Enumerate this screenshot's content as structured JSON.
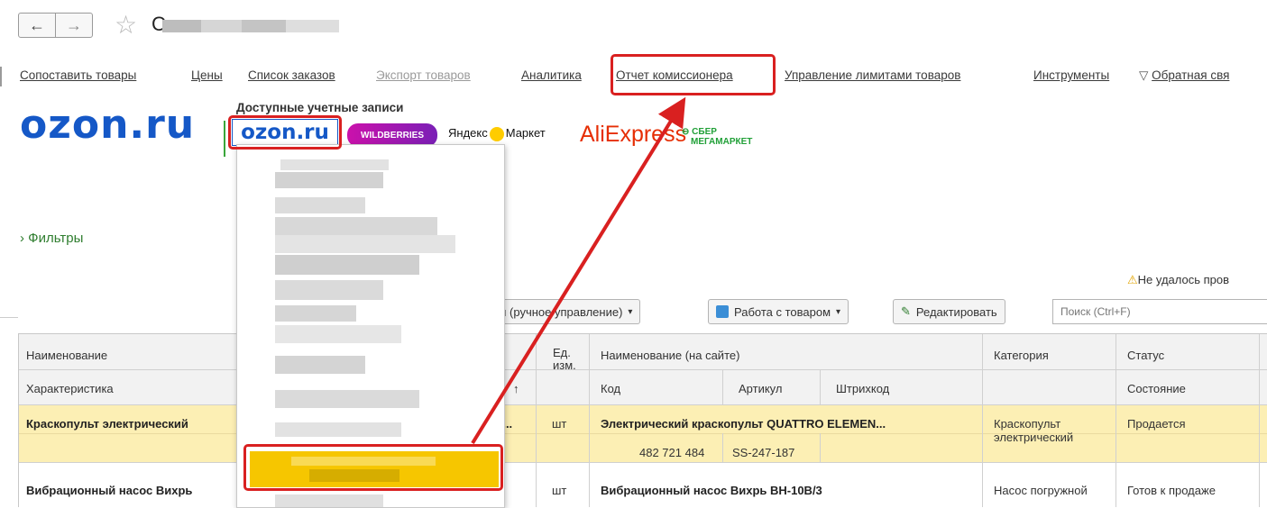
{
  "nav": {
    "back_icon": "←",
    "forward_icon": "→",
    "favorite_icon": "☆",
    "title_visible": "C"
  },
  "menu": {
    "items": [
      {
        "label": "Сопоставить товары",
        "disabled": false
      },
      {
        "label": "Цены",
        "disabled": false
      },
      {
        "label": "Список заказов",
        "disabled": false
      },
      {
        "label": "Экспорт товаров",
        "disabled": true
      },
      {
        "label": "Аналитика",
        "disabled": false
      },
      {
        "label": "Отчет комиссионера",
        "disabled": false,
        "highlighted": true
      },
      {
        "label": "Управление лимитами товаров",
        "disabled": false
      },
      {
        "label": "Инструменты",
        "disabled": false
      },
      {
        "label": "Обратная свя",
        "disabled": false,
        "icon": "filter-icon"
      }
    ]
  },
  "brand": {
    "logo": "ozon.ru",
    "accounts_label": "Доступные учетные записи"
  },
  "marketplaces": {
    "ozon": "ozon.ru",
    "wildberries": "WILDBERRIES",
    "yandex_a": "Яндекс",
    "yandex_b": "Маркет",
    "aliexpress": "AliExpress",
    "sber_a": "СБЕР",
    "sber_b": "МЕГАМАРКЕТ"
  },
  "filters_label": "Фильтры",
  "warning": "Не удалось пров",
  "toolbar": {
    "manual_mgmt": "ами (ручное управление)",
    "work_with_product": "Работа с товаром",
    "edit": "Редактировать",
    "search_placeholder": "Поиск (Ctrl+F)"
  },
  "table": {
    "headers": {
      "name": "Наименование",
      "characteristic": "Характеристика",
      "unit_a": "Ед.",
      "unit_b": "изм.",
      "site_name": "Наименование (на сайте)",
      "code": "Код",
      "article": "Артикул",
      "barcode": "Штрихкод",
      "category": "Категория",
      "status": "Статус",
      "state": "Состояние"
    },
    "sort_indicator": "↑",
    "rows": [
      {
        "name": "Краскопульт электрический",
        "name_tail": "[...",
        "unit": "шт",
        "site_name": "Электрический краскопульт QUATTRO ELEMEN...",
        "code": "482 721 484",
        "article": "SS-247-187",
        "barcode": "",
        "category_a": "Краскопульт",
        "category_b": "электрический",
        "status": "Продается"
      },
      {
        "name": "Вибрационный насос Вихрь",
        "unit": "шт",
        "site_name": "Вибрационный насос Вихрь ВН-10В/3",
        "category": "Насос погружной",
        "status": "Готов к продаже"
      }
    ]
  },
  "colors": {
    "highlight": "#d92020",
    "accent_blue": "#1558c7",
    "selection_yellow": "#f6c600"
  }
}
